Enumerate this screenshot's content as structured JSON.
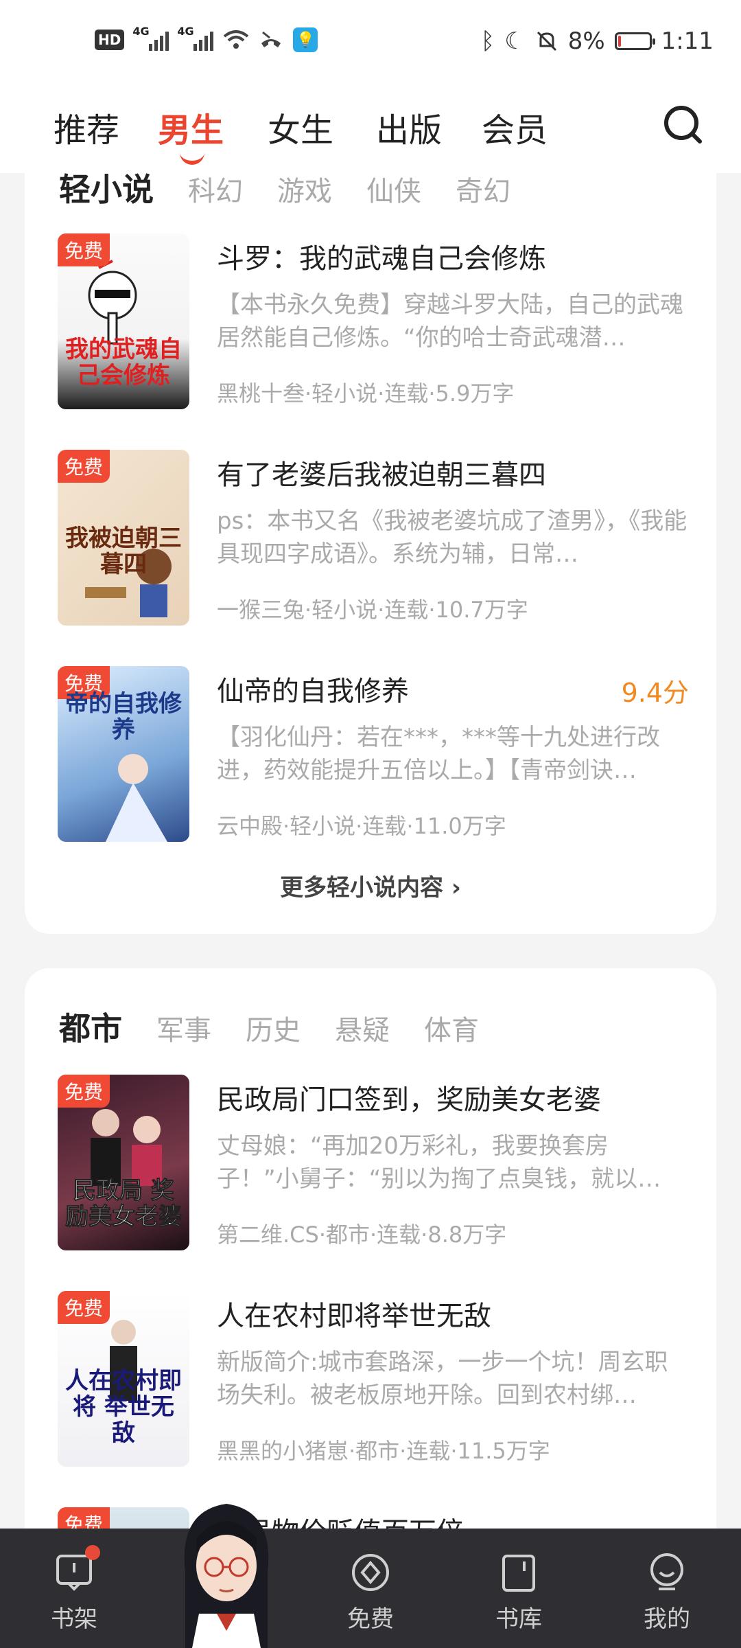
{
  "status_bar": {
    "hd": "HD",
    "sim1": "4G",
    "sim2": "4G",
    "battery_pct": "8%",
    "battery_level": 0.08,
    "time": "1:11"
  },
  "top_tabs": [
    {
      "label": "推荐"
    },
    {
      "label": "男生"
    },
    {
      "label": "女生"
    },
    {
      "label": "出版"
    },
    {
      "label": "会员"
    }
  ],
  "active_tab": "男生",
  "section1": {
    "categories": [
      "轻小说",
      "科幻",
      "游戏",
      "仙侠",
      "奇幻"
    ],
    "books": [
      {
        "badge": "免费",
        "cover_text": "我的武魂自己会修炼",
        "title": "斗罗：我的武魂自己会修炼",
        "desc": "【本书永久免费】穿越斗罗大陆，自己的武魂居然能自己修炼。“你的哈士奇武魂潜…",
        "meta": "黑桃十叁·轻小说·连载·5.9万字"
      },
      {
        "badge": "免费",
        "cover_text": "我被迫朝三暮四",
        "title": "有了老婆后我被迫朝三暮四",
        "desc": "ps：本书又名《我被老婆坑成了渣男》，《我能具现四字成语》。系统为辅，日常…",
        "meta": "一猴三兔·轻小说·连载·10.7万字"
      },
      {
        "badge": "免费",
        "cover_text": "帝的自我修养",
        "title": "仙帝的自我修养",
        "score": "9.4分",
        "desc": "【羽化仙丹：若在***，***等十九处进行改进，药效能提升五倍以上。】【青帝剑诀…",
        "meta": "云中殿·轻小说·连载·11.0万字"
      }
    ],
    "more": "更多轻小说内容 ›"
  },
  "section2": {
    "categories": [
      "都市",
      "军事",
      "历史",
      "悬疑",
      "体育"
    ],
    "books": [
      {
        "badge": "免费",
        "cover_text": "民政局 奖励美女老婆",
        "title": "民政局门口签到，奖励美女老婆",
        "desc": "丈母娘：“再加20万彩礼，我要换套房子！”小舅子：“别以为掏了点臭钱，就以…",
        "meta": "第二维.CS·都市·连载·8.8万字"
      },
      {
        "badge": "免费",
        "cover_text": "人在农村即将 举世无敌",
        "title": "人在农村即将举世无敌",
        "desc": "新版简介:城市套路深，一步一个坑！周玄职场失利。被老板原地开除。回到农村绑…",
        "meta": "黑黑的小猪崽·都市·连载·11.5万字"
      },
      {
        "badge": "免费",
        "title": "开局物价贬值百万倍"
      }
    ]
  },
  "bottom_nav": [
    {
      "label": "书架",
      "icon": "bookshelf-icon"
    },
    {
      "label": "免费",
      "icon": "free-icon"
    },
    {
      "label": "书库",
      "icon": "library-icon"
    },
    {
      "label": "我的",
      "icon": "profile-icon"
    }
  ],
  "colors": {
    "accent": "#e9452f",
    "badge": "#f04a35",
    "score": "#f08a23",
    "bottom_bar": "#2f2f33"
  }
}
